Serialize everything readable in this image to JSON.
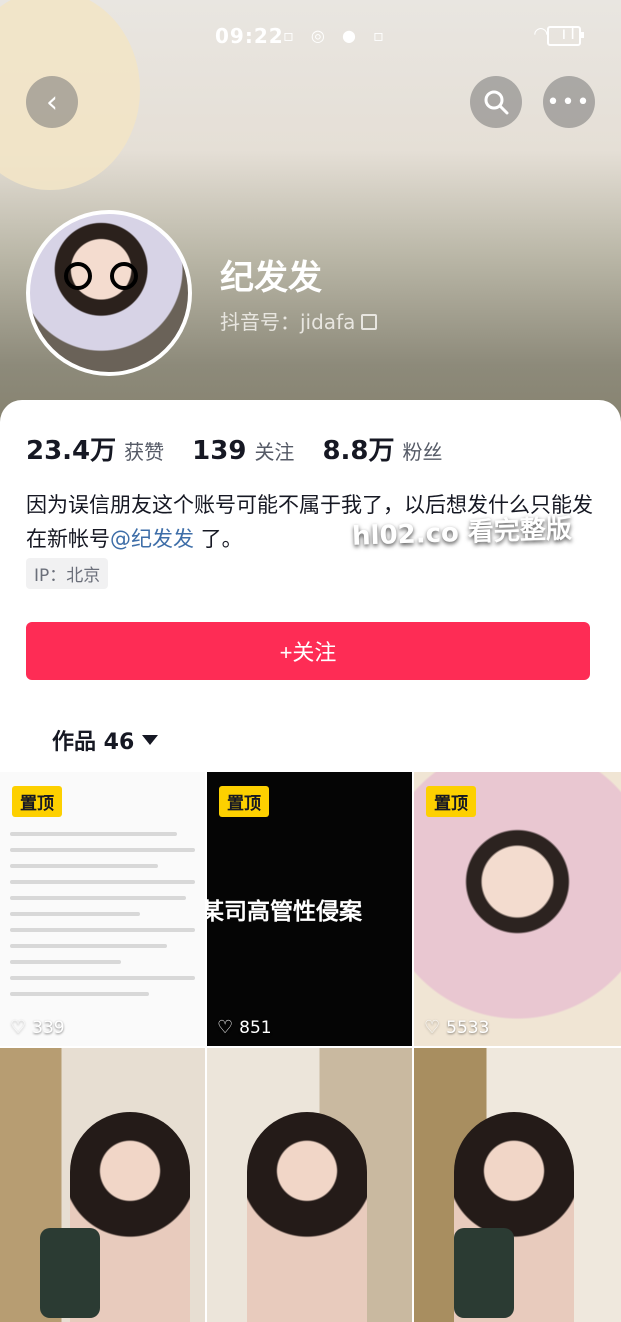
{
  "status_bar": {
    "time": "09:22"
  },
  "header": {
    "nickname": "纪发发",
    "douyin_id": "抖音号：jidafa"
  },
  "stats": [
    {
      "value": "23.4万",
      "label": "获赞"
    },
    {
      "value": "139",
      "label": "关注"
    },
    {
      "value": "8.8万",
      "label": "粉丝"
    }
  ],
  "bio": {
    "text": "因为误信朋友这个账号可能不属于我了，以后想发什么只能发在新帐号",
    "mention": "@纪发发",
    "suffix": " 了。"
  },
  "ip_tag": "IP：北京",
  "follow_button": "+关注",
  "works_tab": "作品 46",
  "videos": [
    {
      "pinned": "置顶",
      "likes": "339"
    },
    {
      "pinned": "置顶",
      "likes": "851",
      "caption": "某司高管性侵案"
    },
    {
      "pinned": "置顶",
      "likes": "5533"
    },
    {},
    {},
    {}
  ],
  "watermark": "hl02.co 看完整版",
  "colors": {
    "accent": "#fe2c55",
    "pin": "#fdd000",
    "mention": "#3e6ea8"
  }
}
